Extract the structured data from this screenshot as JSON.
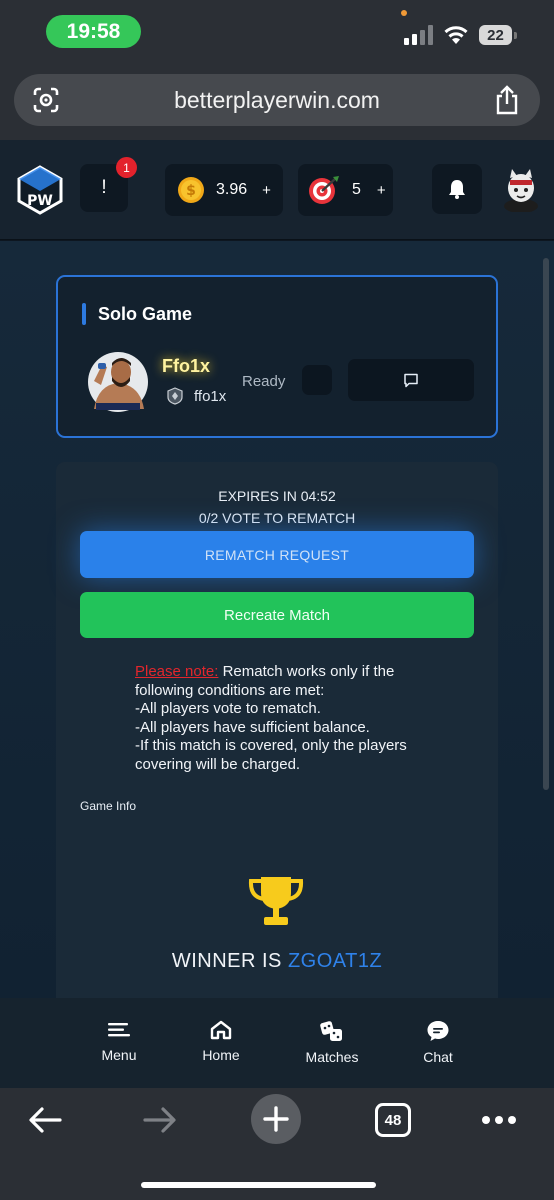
{
  "status_bar": {
    "time": "19:58",
    "battery": "22"
  },
  "browser": {
    "url": "betterplayerwin.com",
    "tabs_count": "48"
  },
  "header": {
    "alert_label": "!",
    "alert_badge": "1",
    "coins": "3.96",
    "coins_plus": "+",
    "targets": "5",
    "targets_plus": "+"
  },
  "solo_card": {
    "title": "Solo Game",
    "player_name": "Ffo1x",
    "player_tag": "ffo1x",
    "status": "Ready"
  },
  "rematch": {
    "expires": "EXPIRES IN 04:52",
    "votes": "0/2 VOTE TO REMATCH",
    "rematch_button": "REMATCH REQUEST",
    "recreate_button": "Recreate Match",
    "note_label": "Please note:",
    "note_text": " Rematch works only if the following conditions are met:",
    "conditions": [
      "-All players vote to rematch.",
      "-All players have sufficient balance.",
      "-If this match is covered, only the players covering will be charged."
    ],
    "game_info": "Game Info",
    "winner_prefix": "WINNER IS ",
    "winner_name": "ZGOAT1Z"
  },
  "nav": {
    "items": [
      {
        "label": "Menu",
        "icon": "menu-icon"
      },
      {
        "label": "Home",
        "icon": "home-icon"
      },
      {
        "label": "Matches",
        "icon": "dice-icon"
      },
      {
        "label": "Chat",
        "icon": "chat-icon"
      }
    ]
  },
  "colors": {
    "accent_blue": "#2a81ea",
    "green": "#22c35a",
    "alert_red": "#e3262c",
    "background": "#112232"
  }
}
